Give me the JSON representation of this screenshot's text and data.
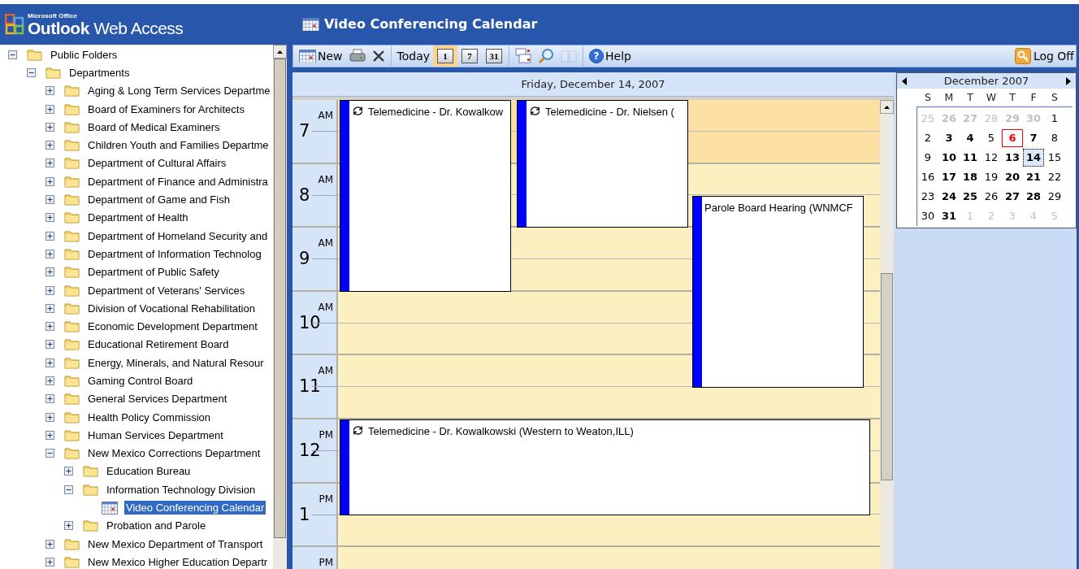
{
  "app": {
    "brand_small": "Microsoft Office",
    "brand": "Outlook",
    "brand_rest": "Web Access"
  },
  "folder_tree": [
    {
      "label": "Public Folders",
      "kind": "folder",
      "expanded": true,
      "selected": false,
      "children": [
        {
          "label": "Departments",
          "kind": "folder",
          "expanded": true,
          "selected": false,
          "children": [
            {
              "label": "Aging & Long Term Services Departme",
              "kind": "folder",
              "expanded": false,
              "selected": false
            },
            {
              "label": "Board of Examiners for Architects",
              "kind": "folder",
              "expanded": false,
              "selected": false
            },
            {
              "label": "Board of Medical Examiners",
              "kind": "folder",
              "expanded": false,
              "selected": false
            },
            {
              "label": "Children Youth and Families Departme",
              "kind": "folder",
              "expanded": false,
              "selected": false
            },
            {
              "label": "Department of Cultural Affairs",
              "kind": "folder",
              "expanded": false,
              "selected": false
            },
            {
              "label": "Department of Finance and Administra",
              "kind": "folder",
              "expanded": false,
              "selected": false
            },
            {
              "label": "Department of Game and Fish",
              "kind": "folder",
              "expanded": false,
              "selected": false
            },
            {
              "label": "Department of Health",
              "kind": "folder",
              "expanded": false,
              "selected": false
            },
            {
              "label": "Department of Homeland Security and",
              "kind": "folder",
              "expanded": false,
              "selected": false
            },
            {
              "label": "Department of Information Technolog",
              "kind": "folder",
              "expanded": false,
              "selected": false
            },
            {
              "label": "Department of Public Safety",
              "kind": "folder",
              "expanded": false,
              "selected": false
            },
            {
              "label": "Department of Veterans' Services",
              "kind": "folder",
              "expanded": false,
              "selected": false
            },
            {
              "label": "Division of Vocational Rehabilitation",
              "kind": "folder",
              "expanded": false,
              "selected": false
            },
            {
              "label": "Economic Development Department",
              "kind": "folder",
              "expanded": false,
              "selected": false
            },
            {
              "label": "Educational Retirement Board",
              "kind": "folder",
              "expanded": false,
              "selected": false
            },
            {
              "label": "Energy, Minerals, and Natural Resour",
              "kind": "folder",
              "expanded": false,
              "selected": false
            },
            {
              "label": "Gaming Control Board",
              "kind": "folder",
              "expanded": false,
              "selected": false
            },
            {
              "label": "General Services Department",
              "kind": "folder",
              "expanded": false,
              "selected": false
            },
            {
              "label": "Health Policy Commission",
              "kind": "folder",
              "expanded": false,
              "selected": false
            },
            {
              "label": "Human Services Department",
              "kind": "folder",
              "expanded": false,
              "selected": false
            },
            {
              "label": "New Mexico Corrections Department",
              "kind": "folder",
              "expanded": true,
              "selected": false,
              "children": [
                {
                  "label": "Education Bureau",
                  "kind": "folder",
                  "expanded": false,
                  "selected": false
                },
                {
                  "label": "Information Technology Division",
                  "kind": "folder",
                  "expanded": true,
                  "selected": false,
                  "children": [
                    {
                      "label": "Video Conferencing Calendar",
                      "kind": "calendar",
                      "selected": true
                    }
                  ]
                },
                {
                  "label": "Probation and Parole",
                  "kind": "folder",
                  "expanded": false,
                  "selected": false
                }
              ]
            },
            {
              "label": "New Mexico Department of Transport",
              "kind": "folder",
              "expanded": false,
              "selected": false
            },
            {
              "label": "New Mexico Higher Education Departr",
              "kind": "folder",
              "expanded": false,
              "selected": false
            }
          ]
        }
      ]
    }
  ],
  "calendar_title": "Video Conferencing Calendar",
  "toolbar": [
    {
      "kind": "new",
      "label": "New",
      "selected": false,
      "disabled": false
    },
    {
      "kind": "print",
      "selected": false,
      "disabled": false
    },
    {
      "kind": "delete",
      "selected": false,
      "disabled": false
    },
    {
      "kind": "separator"
    },
    {
      "kind": "today",
      "label": "Today",
      "selected": false,
      "disabled": false
    },
    {
      "kind": "view",
      "label": "1",
      "selected": true,
      "disabled": false
    },
    {
      "kind": "view",
      "label": "7",
      "selected": false,
      "disabled": false
    },
    {
      "kind": "view",
      "label": "31",
      "selected": false,
      "disabled": false
    },
    {
      "kind": "separator"
    },
    {
      "kind": "options",
      "selected": false,
      "disabled": false
    },
    {
      "kind": "find",
      "selected": false,
      "disabled": false
    },
    {
      "kind": "addressbook",
      "selected": false,
      "disabled": true
    },
    {
      "kind": "separator"
    },
    {
      "kind": "help",
      "icon": "?",
      "label": "Help",
      "selected": false,
      "disabled": false
    }
  ],
  "log_off": "Log Off",
  "day_header": "Friday, December 14, 2007",
  "hours": [
    {
      "hour": "7",
      "period": "AM",
      "working": false
    },
    {
      "hour": "8",
      "period": "AM",
      "working": true
    },
    {
      "hour": "9",
      "period": "AM",
      "working": true
    },
    {
      "hour": "10",
      "period": "AM",
      "working": true
    },
    {
      "hour": "11",
      "period": "AM",
      "working": true
    },
    {
      "hour": "12",
      "period": "PM",
      "working": true
    },
    {
      "hour": "1",
      "period": "PM",
      "working": true
    },
    {
      "period": "PM",
      "working": true
    }
  ],
  "events": [
    {
      "title": "Telemedicine - Dr. Kowalkow",
      "recurring": true
    },
    {
      "title": "Telemedicine - Dr. Nielsen (",
      "recurring": true
    },
    {
      "title": "Parole Board Hearing (WNMCF",
      "recurring": false
    },
    {
      "title": "Telemedicine - Dr. Kowalkowski (Western to Weaton,ILL)",
      "recurring": true
    }
  ],
  "mini_calendar": {
    "month": "December 2007",
    "weekdays": [
      "S",
      "M",
      "T",
      "W",
      "T",
      "F",
      "S"
    ],
    "weeks": [
      [
        {
          "d": "25",
          "other_month": true,
          "bold": false,
          "today": false,
          "selected": false
        },
        {
          "d": "26",
          "other_month": true,
          "bold": true,
          "today": false,
          "selected": false
        },
        {
          "d": "27",
          "other_month": true,
          "bold": true,
          "today": false,
          "selected": false
        },
        {
          "d": "28",
          "other_month": true,
          "bold": false,
          "today": false,
          "selected": false
        },
        {
          "d": "29",
          "other_month": true,
          "bold": true,
          "today": false,
          "selected": false
        },
        {
          "d": "30",
          "other_month": true,
          "bold": true,
          "today": false,
          "selected": false
        },
        {
          "d": "1",
          "other_month": false,
          "bold": false,
          "today": false,
          "selected": false
        }
      ],
      [
        {
          "d": "2",
          "other_month": false,
          "bold": false,
          "today": false,
          "selected": false
        },
        {
          "d": "3",
          "other_month": false,
          "bold": true,
          "today": false,
          "selected": false
        },
        {
          "d": "4",
          "other_month": false,
          "bold": true,
          "today": false,
          "selected": false
        },
        {
          "d": "5",
          "other_month": false,
          "bold": false,
          "today": false,
          "selected": false
        },
        {
          "d": "6",
          "other_month": false,
          "bold": true,
          "today": true,
          "selected": false
        },
        {
          "d": "7",
          "other_month": false,
          "bold": true,
          "today": false,
          "selected": false
        },
        {
          "d": "8",
          "other_month": false,
          "bold": false,
          "today": false,
          "selected": false
        }
      ],
      [
        {
          "d": "9",
          "other_month": false,
          "bold": false,
          "today": false,
          "selected": false
        },
        {
          "d": "10",
          "other_month": false,
          "bold": true,
          "today": false,
          "selected": false
        },
        {
          "d": "11",
          "other_month": false,
          "bold": true,
          "today": false,
          "selected": false
        },
        {
          "d": "12",
          "other_month": false,
          "bold": false,
          "today": false,
          "selected": false
        },
        {
          "d": "13",
          "other_month": false,
          "bold": true,
          "today": false,
          "selected": false
        },
        {
          "d": "14",
          "other_month": false,
          "bold": true,
          "today": false,
          "selected": true
        },
        {
          "d": "15",
          "other_month": false,
          "bold": false,
          "today": false,
          "selected": false
        }
      ],
      [
        {
          "d": "16",
          "other_month": false,
          "bold": false,
          "today": false,
          "selected": false
        },
        {
          "d": "17",
          "other_month": false,
          "bold": true,
          "today": false,
          "selected": false
        },
        {
          "d": "18",
          "other_month": false,
          "bold": true,
          "today": false,
          "selected": false
        },
        {
          "d": "19",
          "other_month": false,
          "bold": false,
          "today": false,
          "selected": false
        },
        {
          "d": "20",
          "other_month": false,
          "bold": true,
          "today": false,
          "selected": false
        },
        {
          "d": "21",
          "other_month": false,
          "bold": true,
          "today": false,
          "selected": false
        },
        {
          "d": "22",
          "other_month": false,
          "bold": false,
          "today": false,
          "selected": false
        }
      ],
      [
        {
          "d": "23",
          "other_month": false,
          "bold": false,
          "today": false,
          "selected": false
        },
        {
          "d": "24",
          "other_month": false,
          "bold": true,
          "today": false,
          "selected": false
        },
        {
          "d": "25",
          "other_month": false,
          "bold": true,
          "today": false,
          "selected": false
        },
        {
          "d": "26",
          "other_month": false,
          "bold": false,
          "today": false,
          "selected": false
        },
        {
          "d": "27",
          "other_month": false,
          "bold": true,
          "today": false,
          "selected": false
        },
        {
          "d": "28",
          "other_month": false,
          "bold": true,
          "today": false,
          "selected": false
        },
        {
          "d": "29",
          "other_month": false,
          "bold": false,
          "today": false,
          "selected": false
        }
      ],
      [
        {
          "d": "30",
          "other_month": false,
          "bold": false,
          "today": false,
          "selected": false
        },
        {
          "d": "31",
          "other_month": false,
          "bold": true,
          "today": false,
          "selected": false
        },
        {
          "d": "1",
          "other_month": true,
          "bold": false,
          "today": false,
          "selected": false
        },
        {
          "d": "2",
          "other_month": true,
          "bold": false,
          "today": false,
          "selected": false
        },
        {
          "d": "3",
          "other_month": true,
          "bold": false,
          "today": false,
          "selected": false
        },
        {
          "d": "4",
          "other_month": true,
          "bold": false,
          "today": false,
          "selected": false
        },
        {
          "d": "5",
          "other_month": true,
          "bold": false,
          "today": false,
          "selected": false
        }
      ]
    ]
  }
}
